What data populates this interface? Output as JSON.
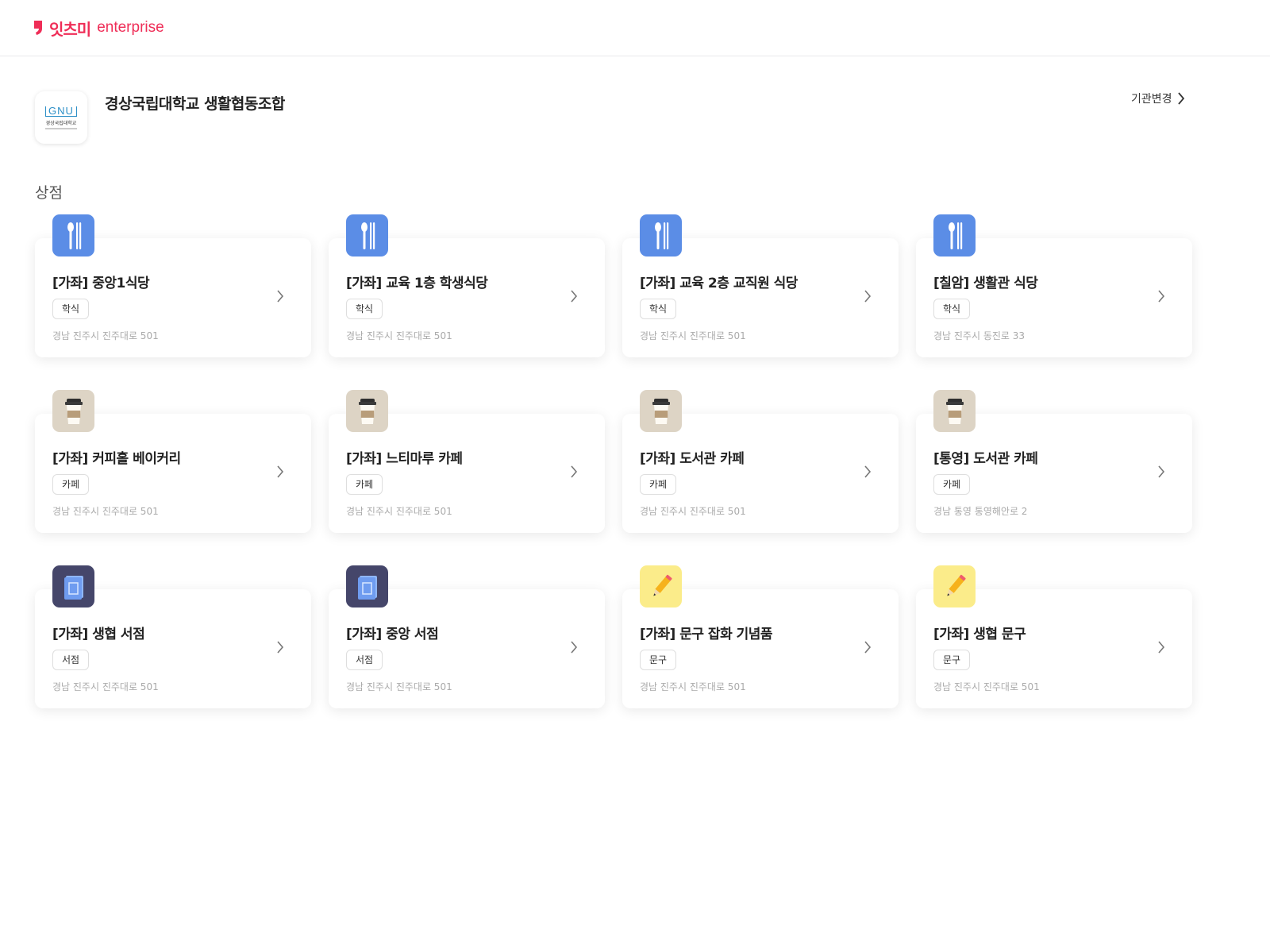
{
  "brand": {
    "name_ko": "잇츠미",
    "name_en": "enterprise",
    "color": "#ef2d57"
  },
  "organization": {
    "logo_text": "GNU",
    "logo_subtext": "경상국립대학교",
    "name": "경상국립대학교 생활협동조합",
    "change_label": "기관변경"
  },
  "section_title": "상점",
  "stores": [
    {
      "name": "[가좌] 중앙1식당",
      "tag": "학식",
      "address": "경남 진주시 진주대로 501",
      "icon": "utensils-icon",
      "icon_bg": "#5b8de6"
    },
    {
      "name": "[가좌] 교육 1층 학생식당",
      "tag": "학식",
      "address": "경남 진주시 진주대로 501",
      "icon": "utensils-icon",
      "icon_bg": "#5b8de6"
    },
    {
      "name": "[가좌] 교육 2층 교직원 식당",
      "tag": "학식",
      "address": "경남 진주시 진주대로 501",
      "icon": "utensils-icon",
      "icon_bg": "#5b8de6"
    },
    {
      "name": "[칠암] 생활관 식당",
      "tag": "학식",
      "address": "경남 진주시 동진로 33",
      "icon": "utensils-icon",
      "icon_bg": "#5b8de6"
    },
    {
      "name": "[가좌] 커피홀 베이커리",
      "tag": "카페",
      "address": "경남 진주시 진주대로 501",
      "icon": "coffee-cup-icon",
      "icon_bg": "#ddd4c5"
    },
    {
      "name": "[가좌] 느티마루 카페",
      "tag": "카페",
      "address": "경남 진주시 진주대로 501",
      "icon": "coffee-cup-icon",
      "icon_bg": "#ddd4c5"
    },
    {
      "name": "[가좌] 도서관 카페",
      "tag": "카페",
      "address": "경남 진주시 진주대로 501",
      "icon": "coffee-cup-icon",
      "icon_bg": "#ddd4c5"
    },
    {
      "name": "[통영] 도서관 카페",
      "tag": "카페",
      "address": "경남 통영 통영해안로 2",
      "icon": "coffee-cup-icon",
      "icon_bg": "#ddd4c5"
    },
    {
      "name": "[가좌] 생협 서점",
      "tag": "서점",
      "address": "경남 진주시 진주대로 501",
      "icon": "book-icon",
      "icon_bg": "#45466a"
    },
    {
      "name": "[가좌] 중앙 서점",
      "tag": "서점",
      "address": "경남 진주시 진주대로 501",
      "icon": "book-icon",
      "icon_bg": "#45466a"
    },
    {
      "name": "[가좌] 문구 잡화 기념품",
      "tag": "문구",
      "address": "경남 진주시 진주대로 501",
      "icon": "pencil-icon",
      "icon_bg": "#fbec8a"
    },
    {
      "name": "[가좌] 생협 문구",
      "tag": "문구",
      "address": "경남 진주시 진주대로 501",
      "icon": "pencil-icon",
      "icon_bg": "#fbec8a"
    }
  ]
}
